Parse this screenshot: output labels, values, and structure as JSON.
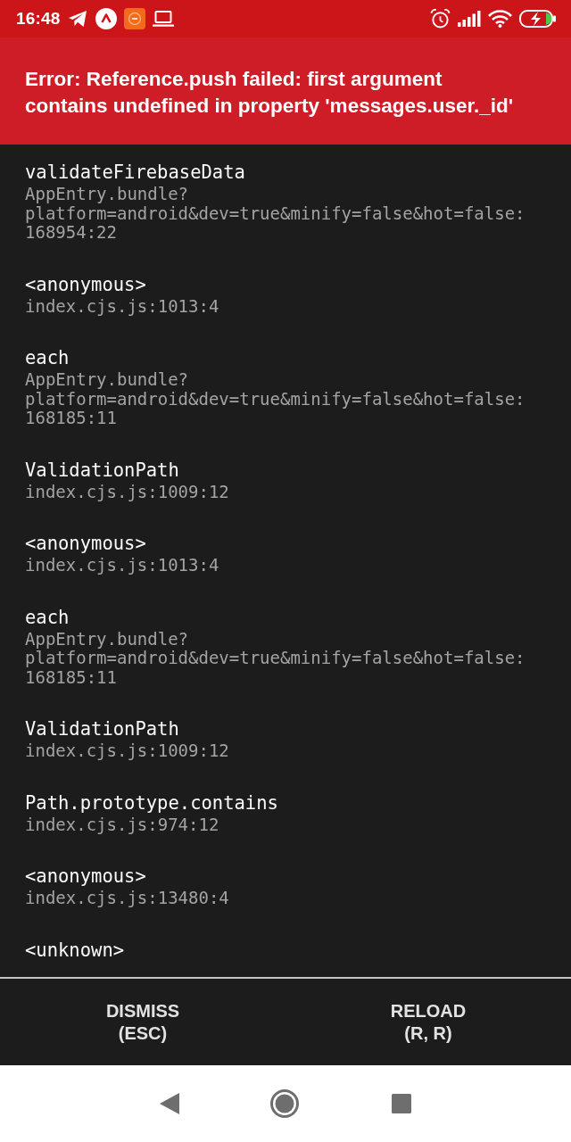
{
  "status_bar": {
    "time": "16:48"
  },
  "error": {
    "message": "Error: Reference.push failed: first argument contains undefined in property 'messages.user._id'"
  },
  "stack_frames": [
    {
      "method": "validateFirebaseData",
      "location": "AppEntry.bundle?\nplatform=android&dev=true&minify=false&hot=false:\n168954:22"
    },
    {
      "method": "<anonymous>",
      "location": "index.cjs.js:1013:4"
    },
    {
      "method": "each",
      "location": "AppEntry.bundle?\nplatform=android&dev=true&minify=false&hot=false:\n168185:11"
    },
    {
      "method": "ValidationPath",
      "location": "index.cjs.js:1009:12"
    },
    {
      "method": "<anonymous>",
      "location": "index.cjs.js:1013:4"
    },
    {
      "method": "each",
      "location": "AppEntry.bundle?\nplatform=android&dev=true&minify=false&hot=false:\n168185:11"
    },
    {
      "method": "ValidationPath",
      "location": "index.cjs.js:1009:12"
    },
    {
      "method": "Path.prototype.contains",
      "location": "index.cjs.js:974:12"
    },
    {
      "method": "<anonymous>",
      "location": "index.cjs.js:13480:4"
    },
    {
      "method": "<unknown>"
    }
  ],
  "buttons": [
    {
      "label": "DISMISS",
      "shortcut": "(ESC)"
    },
    {
      "label": "RELOAD",
      "shortcut": "(R, R)"
    }
  ]
}
